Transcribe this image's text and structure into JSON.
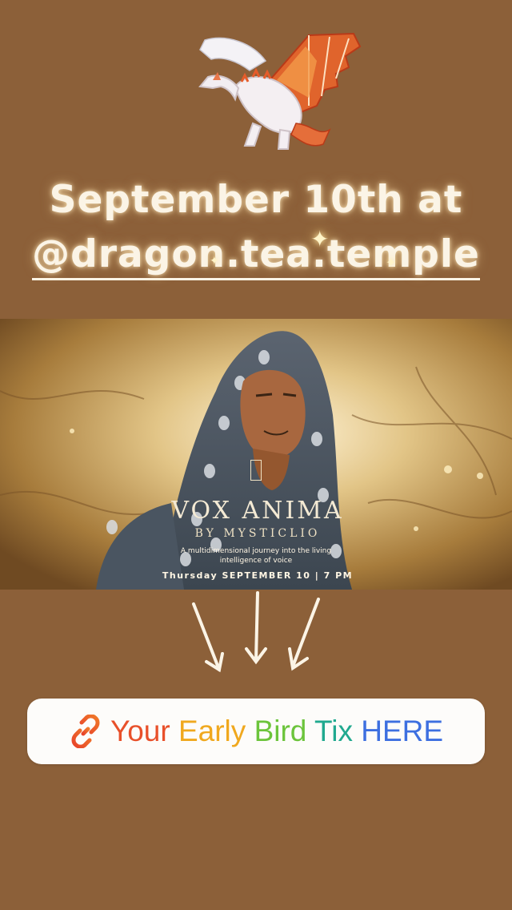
{
  "headline": {
    "line1": "September 10th at",
    "line2": "@dragon.tea.temple"
  },
  "poster": {
    "title": "VOX ANIMA",
    "byline": "BY MYSTICLIO",
    "subtitle": "A multidimensional journey into the living intelligence of voice",
    "date_line": "Thursday SEPTEMBER 10 | 7 PM"
  },
  "link_sticker": {
    "icon": "link-icon",
    "words": [
      {
        "text": "Your",
        "color": "#e8502a"
      },
      {
        "text": "Early",
        "color": "#f0a81e"
      },
      {
        "text": "Bird",
        "color": "#6cc43b"
      },
      {
        "text": "Tix",
        "color": "#20a98f"
      },
      {
        "text": "HERE",
        "color": "#3d6fe0"
      }
    ],
    "label_prefix": "",
    "label": "Your Early Bird Tix HERE"
  },
  "colors": {
    "background": "#8c6039",
    "headline_text": "#fbf4e6"
  },
  "decorations": {
    "top_sticker": "dragon-sticker",
    "arrows": "down-arrows-doodle"
  }
}
